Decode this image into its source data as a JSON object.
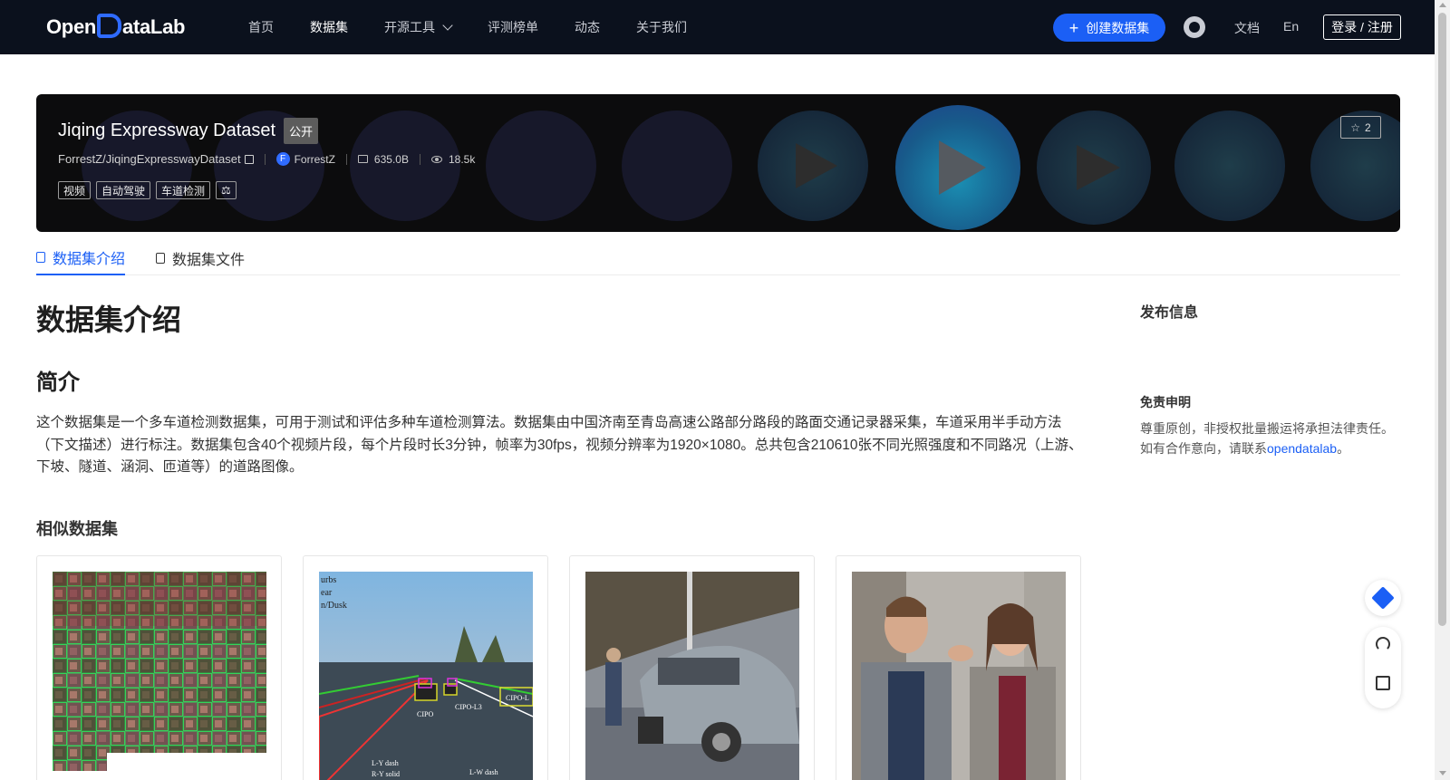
{
  "nav": {
    "logo": "OpenDataLab",
    "links": [
      "首页",
      "数据集",
      "开源工具",
      "评测榜单",
      "动态",
      "关于我们"
    ],
    "create_label": "创建数据集",
    "docs": "文档",
    "lang": "En",
    "login": "登录 / 注册"
  },
  "dataset": {
    "title": "Jiqing Expressway Dataset",
    "visibility": "公开",
    "path": "ForrestZ/JiqingExpresswayDataset",
    "owner_initial": "F",
    "owner": "ForrestZ",
    "size": "635.0B",
    "views": "18.5k",
    "tags": [
      "视频",
      "自动驾驶",
      "车道检测"
    ],
    "license_icon": "scale-icon",
    "stars": "2"
  },
  "tabs": [
    {
      "label": "数据集介绍",
      "icon": "database-icon"
    },
    {
      "label": "数据集文件",
      "icon": "file-icon"
    }
  ],
  "content": {
    "heading": "数据集介绍",
    "intro_heading": "简介",
    "description": "这个数据集是一个多车道检测数据集，可用于测试和评估多种车道检测算法。数据集由中国济南至青岛高速公路部分路段的路面交通记录器采集，车道采用半手动方法（下文描述）进行标注。数据集包含40个视频片段，每个片段时长3分钟，帧率为30fps，视频分辨率为1920×1080。总共包含210610张不同光照强度和不同路况（上游、下坡、隧道、涵洞、匝道等）的道路图像。",
    "similar_heading": "相似数据集"
  },
  "similar": [
    {
      "thumb_labels": []
    },
    {
      "thumb_labels": [
        "urbs",
        "ear",
        "n/Dusk",
        "CIPO",
        "CIPO-L3",
        "CIPO-L",
        "L-Y dash",
        "R-Y solid",
        "L-W dash"
      ]
    },
    {
      "thumb_labels": []
    },
    {
      "thumb_labels": []
    }
  ],
  "sidebar": {
    "publish_heading": "发布信息",
    "disclaimer_heading": "免责申明",
    "disclaimer_text": "尊重原创，非授权批量搬运将承担法律责任。如有合作意向，请联系",
    "contact_link": "opendatalab",
    "period": "。"
  },
  "colors": {
    "nav_bg": "#0b111d",
    "accent": "#1b5ff5",
    "banner_bg": "#0c0c0d"
  }
}
